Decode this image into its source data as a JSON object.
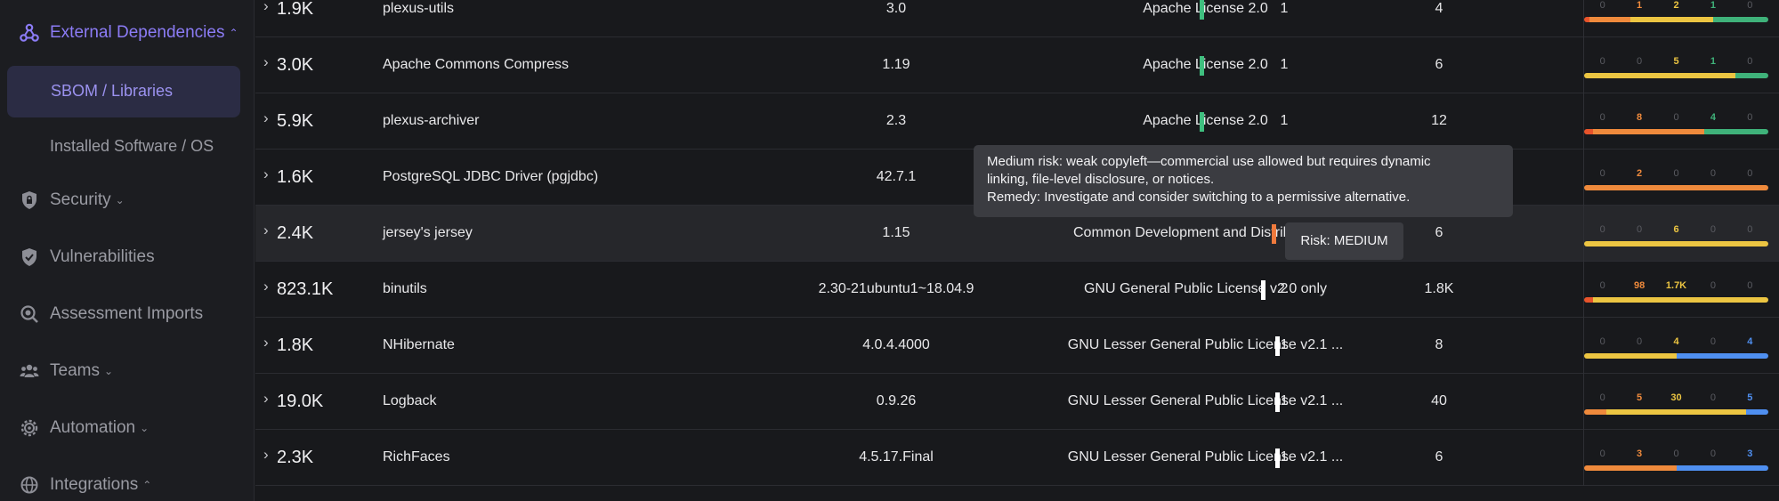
{
  "sidebar": {
    "external_dependencies": "External Dependencies",
    "sbom_libraries": "SBOM / Libraries",
    "installed_software": "Installed Software / OS",
    "security": "Security",
    "vulnerabilities": "Vulnerabilities",
    "assessment_imports": "Assessment Imports",
    "teams": "Teams",
    "automation": "Automation",
    "integrations": "Integrations",
    "chevron_up": "⌃",
    "chevron_down": "⌄"
  },
  "colors": {
    "accent": "#8c7cf6",
    "low": "#3fbf7f",
    "medium": "#ef7a3d",
    "high_white": "#ffffff",
    "vuln_critical": "#e8542b",
    "vuln_high": "#ef8a3c",
    "vuln_medium": "#ecc542",
    "vuln_low": "#3fb27a",
    "vuln_info": "#4f8ff0"
  },
  "rows": [
    {
      "caret": "›",
      "size": "1.9K",
      "name": "plexus-utils",
      "version": "3.0",
      "license": "Apache License 2.0",
      "risk": "low",
      "c1": "1",
      "c2": "4",
      "vulns": [
        "0",
        "1",
        "2",
        "1",
        "0"
      ]
    },
    {
      "caret": "›",
      "size": "3.0K",
      "name": "Apache Commons Compress",
      "version": "1.19",
      "license": "Apache License 2.0",
      "risk": "low",
      "c1": "1",
      "c2": "6",
      "vulns": [
        "0",
        "0",
        "5",
        "1",
        "0"
      ]
    },
    {
      "caret": "›",
      "size": "5.9K",
      "name": "plexus-archiver",
      "version": "2.3",
      "license": "Apache License 2.0",
      "risk": "low",
      "c1": "1",
      "c2": "12",
      "vulns": [
        "0",
        "8",
        "0",
        "4",
        "0"
      ]
    },
    {
      "caret": "›",
      "size": "1.6K",
      "name": "PostgreSQL JDBC Driver (pgjdbc)",
      "version": "42.7.1",
      "license": "",
      "risk": "none",
      "c1": "",
      "c2": "",
      "vulns": [
        "0",
        "2",
        "0",
        "0",
        "0"
      ]
    },
    {
      "caret": "›",
      "size": "2.4K",
      "name": "jersey's jersey",
      "version": "1.15",
      "license": "Common Development and Distribution ...",
      "risk": "medium",
      "c1": "",
      "c2": "6",
      "vulns": [
        "0",
        "0",
        "6",
        "0",
        "0"
      ]
    },
    {
      "caret": "›",
      "size": "823.1K",
      "name": "binutils",
      "version": "2.30-21ubuntu1~18.04.9",
      "license": "GNU General Public License v2.0 only",
      "risk": "high",
      "c1": "2",
      "c2": "1.8K",
      "vulns": [
        "0",
        "98",
        "1.7K",
        "0",
        "0"
      ]
    },
    {
      "caret": "›",
      "size": "1.8K",
      "name": "NHibernate",
      "version": "4.0.4.4000",
      "license": "GNU Lesser General Public License v2.1 ...",
      "risk": "high",
      "c1": "1",
      "c2": "8",
      "vulns": [
        "0",
        "0",
        "4",
        "0",
        "4"
      ]
    },
    {
      "caret": "›",
      "size": "19.0K",
      "name": "Logback",
      "version": "0.9.26",
      "license": "GNU Lesser General Public License v2.1 ...",
      "risk": "high",
      "c1": "1",
      "c2": "40",
      "vulns": [
        "0",
        "5",
        "30",
        "0",
        "5"
      ]
    },
    {
      "caret": "›",
      "size": "2.3K",
      "name": "RichFaces",
      "version": "4.5.17.Final",
      "license": "GNU Lesser General Public License v2.1 ...",
      "risk": "high",
      "c1": "1",
      "c2": "6",
      "vulns": [
        "0",
        "3",
        "0",
        "0",
        "3"
      ]
    }
  ],
  "vuln_bars": [
    [
      [
        "#e8542b",
        0.03
      ],
      [
        "#ef8a3c",
        0.22
      ],
      [
        "#ecc542",
        0.45
      ],
      [
        "#3fb27a",
        0.3
      ]
    ],
    [
      [
        "#ecc542",
        0.82
      ],
      [
        "#3fb27a",
        0.18
      ]
    ],
    [
      [
        "#e8542b",
        0.05
      ],
      [
        "#ef8a3c",
        0.6
      ],
      [
        "#3fb27a",
        0.35
      ]
    ],
    [
      [
        "#ef8a3c",
        1.0
      ]
    ],
    [
      [
        "#ecc542",
        1.0
      ]
    ],
    [
      [
        "#e8542b",
        0.05
      ],
      [
        "#ecc542",
        0.95
      ]
    ],
    [
      [
        "#ecc542",
        0.5
      ],
      [
        "#4f8ff0",
        0.5
      ]
    ],
    [
      [
        "#ef8a3c",
        0.12
      ],
      [
        "#ecc542",
        0.76
      ],
      [
        "#4f8ff0",
        0.12
      ]
    ],
    [
      [
        "#ef8a3c",
        0.5
      ],
      [
        "#4f8ff0",
        0.5
      ]
    ]
  ],
  "tooltip": {
    "line1": "Medium risk: weak copyleft—commercial use allowed but requires dynamic",
    "line2": "linking, file-level disclosure, or notices.",
    "line3": "Remedy: Investigate and consider switching to a permissive alternative."
  },
  "risk_badge": "Risk: MEDIUM"
}
